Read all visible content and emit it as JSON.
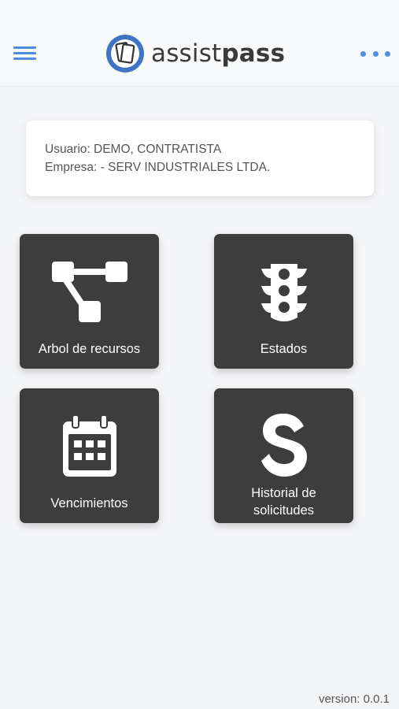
{
  "header": {
    "logo_light": "assist",
    "logo_bold": "pass",
    "menu_icon": "hamburger-icon",
    "more_icon": "ellipsis-icon",
    "accent_color": "#4a8fe0"
  },
  "user_info": {
    "user_line": "Usuario: DEMO, CONTRATISTA",
    "company_line": "Empresa: - SERV INDUSTRIALES LTDA."
  },
  "tiles": [
    {
      "label": "Arbol de recursos",
      "icon": "tree-icon"
    },
    {
      "label": "Estados",
      "icon": "traffic-light-icon"
    },
    {
      "label": "Vencimientos",
      "icon": "calendar-icon"
    },
    {
      "label_line1": "Historial de",
      "label_line2": "solicitudes",
      "icon": "letter-s-icon"
    }
  ],
  "footer": {
    "version": "version: 0.0.1"
  },
  "colors": {
    "tile_bg": "#3d3d3d",
    "page_bg": "#f4f5f7"
  }
}
